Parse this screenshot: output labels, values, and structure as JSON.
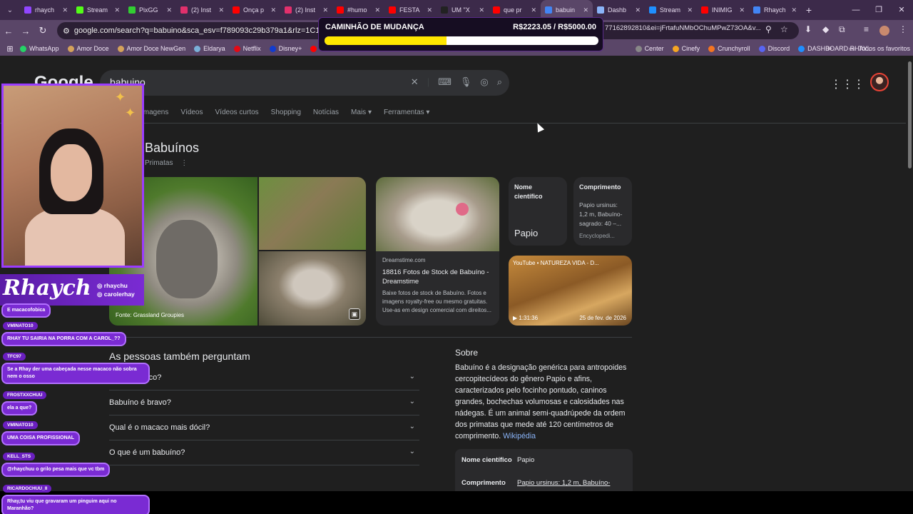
{
  "tabs": [
    {
      "label": "rhaych",
      "color": "#9146ff"
    },
    {
      "label": "Stream",
      "color": "#53fc18"
    },
    {
      "label": "PixGG",
      "color": "#32cd32"
    },
    {
      "label": "(2) Inst",
      "color": "#e1306c"
    },
    {
      "label": "Onça p",
      "color": "#ff0000"
    },
    {
      "label": "(2) Inst",
      "color": "#e1306c"
    },
    {
      "label": "#humo",
      "color": "#ff0000"
    },
    {
      "label": "FESTA",
      "color": "#ff0000"
    },
    {
      "label": "UM \"X",
      "color": "#222222"
    },
    {
      "label": "que pr",
      "color": "#ff0000"
    },
    {
      "label": "babuin",
      "color": "#4285f4"
    },
    {
      "label": "Dashb",
      "color": "#8ab4f8"
    },
    {
      "label": "Stream",
      "color": "#1f8fff"
    },
    {
      "label": "INIMIG",
      "color": "#ff0000"
    },
    {
      "label": "Rhaych",
      "color": "#4285f4"
    }
  ],
  "address": {
    "url": "google.com/search?q=babuino&sca_esv=f789093c29b379a1&rlz=1C1VDKB_pt-PT",
    "url_tail": "77162892810&ei=jFrtafuNMbOChuMPwZ73OA&v..."
  },
  "bookmarks": [
    {
      "label": "WhatsApp",
      "color": "#25d366"
    },
    {
      "label": "Amor Doce",
      "color": "#d4a25a"
    },
    {
      "label": "Amor Doce NewGen",
      "color": "#d4a25a"
    },
    {
      "label": "Eldarya",
      "color": "#7ab0d8"
    },
    {
      "label": "Netflix",
      "color": "#e50914"
    },
    {
      "label": "Disney+",
      "color": "#113ccf"
    },
    {
      "label": "Yo",
      "color": "#ff0000"
    },
    {
      "label": "Center",
      "color": "#888888"
    },
    {
      "label": "Cinefy",
      "color": "#f5a623"
    },
    {
      "label": "Crunchyroll",
      "color": "#f47521"
    },
    {
      "label": "Discord",
      "color": "#5865f2"
    },
    {
      "label": "DASHBOARD RHAY...",
      "color": "#1f8fff"
    }
  ],
  "bookmarks_other": "Todos os favoritos",
  "google": {
    "logo": "Google",
    "query": "babuino",
    "nav_tabs": [
      "Imagens",
      "Vídeos",
      "Vídeos curtos",
      "Shopping",
      "Notícias",
      "Mais ▾",
      "Ferramentas ▾"
    ],
    "kp_title": "Babuínos",
    "kp_subtitle": "Primatas",
    "main_image_caption": "Fonte: Grassland Groupies",
    "dreamstime": {
      "source": "Dreamstime.com",
      "title": "18816 Fotos de Stock de Babuíno - Dreamstime",
      "desc": "Baixe fotos de stock de Babuíno. Fotos e imagens royalty-free ou mesmo gratuitas. Use-as em design comercial com direitos..."
    },
    "fact_scientific": {
      "label": "Nome científico",
      "value": "Papio"
    },
    "fact_length": {
      "label": "Comprimento",
      "value": "Papio ursinus: 1,2 m, Babuíno-sagrado: 40 –...",
      "source": "Encyclopedi..."
    },
    "video": {
      "channel": "YouTube • NATUREZA VIDA - D...",
      "duration": "▶ 1:31:36",
      "date": "25 de fev. de 2026"
    },
    "paa_title": "As pessoas também perguntam",
    "paa": [
      "É um macaco?",
      "Babuíno é bravo?",
      "Qual é o macaco mais dócil?",
      "O que é um babuíno?"
    ],
    "sobre_title": "Sobre",
    "sobre_text": "Babuíno é a designação genérica para antropoides cercopitecídeos do gênero Papio e afins, caracterizados pelo focinho pontudo, caninos grandes, bochechas volumosas e calosidades nas nádegas. É um animal semi-quadrúpede da ordem dos primatas que mede até 120 centímetros de comprimento.",
    "sobre_link": "Wikipédia",
    "facts": [
      {
        "k": "Nome científico",
        "v": "Papio"
      },
      {
        "k": "Comprimento",
        "v": "Papio ursinus: 1,2 m, Babuíno-"
      }
    ]
  },
  "goal": {
    "title": "CAMINHÃO DE MUDANÇA",
    "amount": "R$2223.05 / R$5000.00",
    "progress": 0.4446
  },
  "overlay": {
    "brand": "Rhaych",
    "handles": [
      "◎ rhaychu",
      "◎ carolerhay"
    ]
  },
  "chat": [
    {
      "user": "",
      "text": "E macacofobica"
    },
    {
      "user": "VMINATO10",
      "text": "RHAY TU SAIRIA NA PORRA COM A CAROL_??"
    },
    {
      "user": "TFC97",
      "text": "Se a Rhay der uma cabeçada nesse macaco não sobra nem o osso"
    },
    {
      "user": "FROSTXXCHUU",
      "text": "ela a que?"
    },
    {
      "user": "VMINATO10",
      "text": "UMA COISA PROFISSIONAL"
    },
    {
      "user": "KELL_STS",
      "text": "@rhaychuu o grilo pesa mais que vc tbm"
    },
    {
      "user": "RICARDOCHUU_II",
      "text": "Rhay,tu viu que gravaram um pinguim aqui no Maranhão?"
    }
  ]
}
